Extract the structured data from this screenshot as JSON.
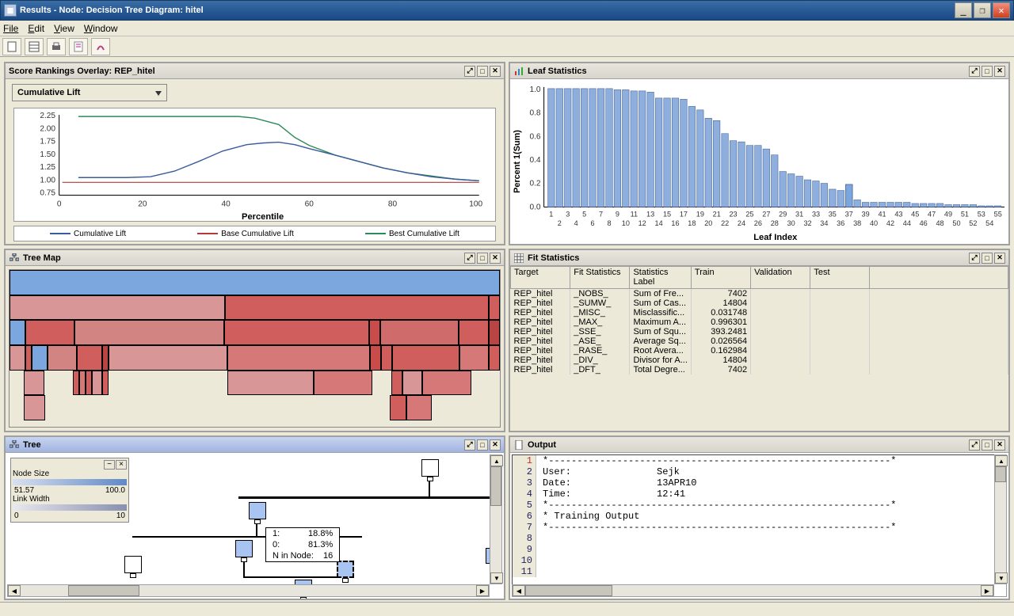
{
  "window": {
    "title": "Results - Node: Decision Tree  Diagram: hitel"
  },
  "menu": {
    "file": "File",
    "edit": "Edit",
    "view": "View",
    "window": "Window"
  },
  "panels": {
    "score": {
      "title": "Score Rankings Overlay: REP_hitel",
      "dropdown": "Cumulative Lift",
      "xlabel": "Percentile",
      "legend": {
        "cum": "Cumulative Lift",
        "base": "Base Cumulative Lift",
        "best": "Best Cumulative Lift"
      }
    },
    "leaf": {
      "title": "Leaf Statistics",
      "xlabel": "Leaf Index",
      "ylabel": "Percent 1(Sum)"
    },
    "treemap": {
      "title": "Tree Map"
    },
    "fit": {
      "title": "Fit Statistics",
      "cols": {
        "target": "Target",
        "fitstat": "Fit Statistics",
        "label": "Statistics Label",
        "train": "Train",
        "validation": "Validation",
        "test": "Test"
      },
      "rows": [
        {
          "t": "REP_hitel",
          "s": "_NOBS_",
          "l": "Sum of Fre...",
          "tr": "7402"
        },
        {
          "t": "REP_hitel",
          "s": "_SUMW_",
          "l": "Sum of Cas...",
          "tr": "14804"
        },
        {
          "t": "REP_hitel",
          "s": "_MISC_",
          "l": "Misclassific...",
          "tr": "0.031748"
        },
        {
          "t": "REP_hitel",
          "s": "_MAX_",
          "l": "Maximum A...",
          "tr": "0.996301"
        },
        {
          "t": "REP_hitel",
          "s": "_SSE_",
          "l": "Sum of Squ...",
          "tr": "393.2481"
        },
        {
          "t": "REP_hitel",
          "s": "_ASE_",
          "l": "Average Sq...",
          "tr": "0.026564"
        },
        {
          "t": "REP_hitel",
          "s": "_RASE_",
          "l": "Root Avera...",
          "tr": "0.162984"
        },
        {
          "t": "REP_hitel",
          "s": "_DIV_",
          "l": "Divisor for A...",
          "tr": "14804"
        },
        {
          "t": "REP_hitel",
          "s": "_DFT_",
          "l": "Total Degre...",
          "tr": "7402"
        }
      ]
    },
    "tree": {
      "title": "Tree",
      "legend": {
        "nodeSize": "Node Size",
        "nsMin": "51.57",
        "nsMax": "100.0",
        "linkWidth": "Link Width",
        "lwMin": "0",
        "lwMax": "10"
      },
      "tooltip": {
        "r1k": "1:",
        "r1v": "18.8%",
        "r2k": "0:",
        "r2v": "81.3%",
        "r3k": "N in Node:",
        "r3v": "16"
      }
    },
    "output": {
      "title": "Output",
      "lines": [
        "*------------------------------------------------------------*",
        "User:               Sejk",
        "Date:               13APR10",
        "Time:               12:41",
        "*------------------------------------------------------------*",
        "* Training Output",
        "*------------------------------------------------------------*",
        "",
        "",
        "",
        ""
      ]
    }
  },
  "chart_data": [
    {
      "type": "line",
      "title": "Score Rankings Overlay: REP_hitel",
      "xlabel": "Percentile",
      "ylabel": "",
      "xlim": [
        0,
        100
      ],
      "ylim": [
        0.75,
        2.25
      ],
      "yticks": [
        0.75,
        1.0,
        1.25,
        1.5,
        1.75,
        2.0,
        2.25
      ],
      "xticks": [
        0,
        20,
        40,
        60,
        80,
        100
      ],
      "series": [
        {
          "name": "Cumulative Lift",
          "color": "#3b5b9c",
          "x": [
            5,
            10,
            15,
            20,
            25,
            30,
            35,
            40,
            45,
            50,
            55,
            60,
            65,
            70,
            75,
            80,
            85,
            90,
            95,
            100
          ],
          "y": [
            1.1,
            1.1,
            1.1,
            1.12,
            1.22,
            1.36,
            1.52,
            1.66,
            1.73,
            1.75,
            1.7,
            1.6,
            1.48,
            1.38,
            1.28,
            1.2,
            1.14,
            1.1,
            1.07,
            1.05
          ]
        },
        {
          "name": "Base Cumulative Lift",
          "color": "#b23a3a",
          "x": [
            5,
            100
          ],
          "y": [
            1.0,
            1.0
          ]
        },
        {
          "name": "Best Cumulative Lift",
          "color": "#2e8b57",
          "x": [
            5,
            10,
            15,
            20,
            25,
            30,
            35,
            40,
            45,
            50,
            55,
            60,
            65,
            70,
            75,
            80,
            85,
            90,
            95,
            100
          ],
          "y": [
            2.07,
            2.07,
            2.07,
            2.07,
            2.07,
            2.07,
            2.07,
            2.07,
            2.05,
            1.98,
            1.8,
            1.65,
            1.54,
            1.43,
            1.33,
            1.25,
            1.18,
            1.12,
            1.08,
            1.05
          ]
        }
      ]
    },
    {
      "type": "bar",
      "title": "Leaf Statistics",
      "xlabel": "Leaf Index",
      "ylabel": "Percent 1(Sum)",
      "ylim": [
        0,
        1.0
      ],
      "yticks": [
        0.0,
        0.2,
        0.4,
        0.6,
        0.8,
        1.0
      ],
      "categories": [
        1,
        2,
        3,
        4,
        5,
        6,
        7,
        8,
        9,
        10,
        11,
        12,
        13,
        14,
        15,
        16,
        17,
        18,
        19,
        20,
        21,
        22,
        23,
        24,
        25,
        26,
        27,
        28,
        29,
        30,
        31,
        32,
        33,
        34,
        35,
        36,
        37,
        38,
        39,
        40,
        41,
        42,
        43,
        44,
        45,
        46,
        47,
        48,
        49,
        50,
        51,
        52,
        53,
        54,
        55
      ],
      "values": [
        1.0,
        1.0,
        1.0,
        1.0,
        1.0,
        1.0,
        1.0,
        1.0,
        0.99,
        0.99,
        0.98,
        0.98,
        0.97,
        0.92,
        0.92,
        0.92,
        0.91,
        0.85,
        0.82,
        0.75,
        0.73,
        0.62,
        0.56,
        0.55,
        0.52,
        0.52,
        0.49,
        0.44,
        0.3,
        0.28,
        0.26,
        0.23,
        0.22,
        0.2,
        0.15,
        0.14,
        0.19,
        0.06,
        0.04,
        0.04,
        0.04,
        0.04,
        0.04,
        0.04,
        0.03,
        0.03,
        0.03,
        0.03,
        0.02,
        0.02,
        0.02,
        0.02,
        0.01,
        0.01,
        0.01
      ]
    }
  ]
}
